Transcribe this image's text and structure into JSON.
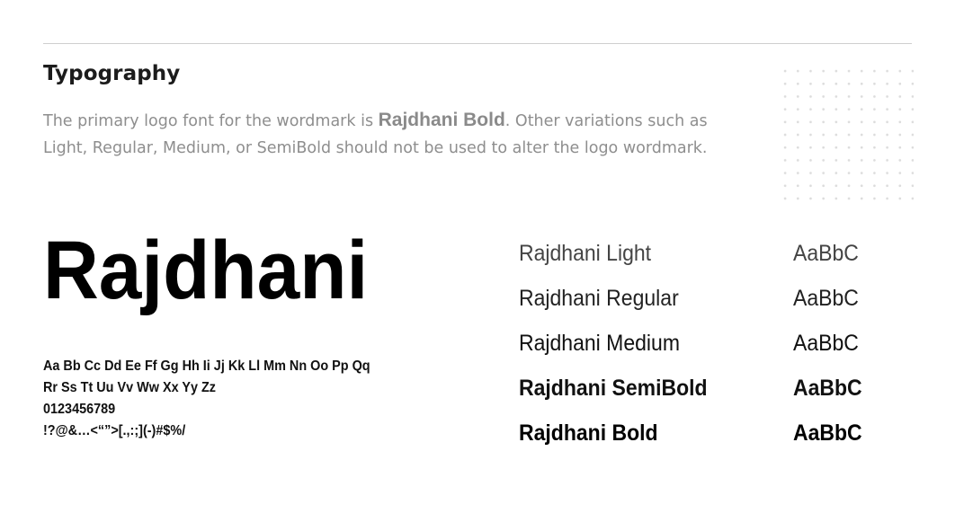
{
  "section": {
    "title": "Typography",
    "description": {
      "before": "The primary logo font for the wordmark is ",
      "emphasis": "Rajdhani Bold",
      "after": ". Other variations such as Light, Regular, Medium, or SemiBold should not be used to alter the logo wordmark."
    }
  },
  "specimen": {
    "display": "Rajdhani",
    "charset": [
      "Aa Bb Cc Dd Ee Ff Gg Hh Ii Jj Kk Ll Mm Nn Oo Pp Qq",
      "Rr Ss Tt Uu Vv Ww Xx Yy Zz",
      "0123456789",
      "!?@&…<“”>[.,:;](-)#$%/"
    ]
  },
  "weights": [
    {
      "name": "Rajdhani Light",
      "sample": "AaBbC"
    },
    {
      "name": "Rajdhani Regular",
      "sample": "AaBbC"
    },
    {
      "name": "Rajdhani Medium",
      "sample": "AaBbC"
    },
    {
      "name": "Rajdhani SemiBold",
      "sample": "AaBbC"
    },
    {
      "name": "Rajdhani Bold",
      "sample": "AaBbC"
    }
  ],
  "colors": {
    "text": "#111111",
    "muted": "#8e8e8e",
    "rule": "#cfcfcf",
    "dots": "#dcdcdc"
  }
}
